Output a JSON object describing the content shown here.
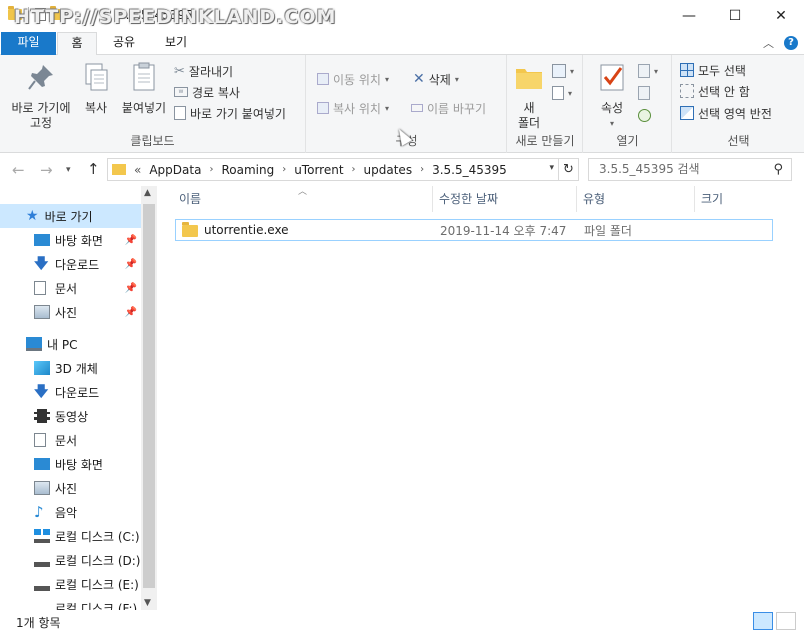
{
  "window": {
    "title": "3.5.5_45395",
    "watermark": "HTTP://SPEEDINKLAND.COM",
    "minimize": "—",
    "maximize": "☐",
    "close": "✕"
  },
  "tabs": [
    "파일",
    "홈",
    "공유",
    "보기"
  ],
  "ribbon": {
    "clipboard": {
      "label": "클립보드",
      "pin_quick": "바로 가기에\n고정",
      "copy": "복사",
      "paste": "붙여넣기",
      "cut": "잘라내기",
      "copy_path": "경로 복사",
      "paste_shortcut": "바로 가기 붙여넣기"
    },
    "organize": {
      "label": "구성",
      "move_to": "이동 위치",
      "copy_to": "복사 위치",
      "delete": "삭제",
      "rename": "이름 바꾸기"
    },
    "new": {
      "label": "새로 만들기",
      "new_folder": "새\n폴더"
    },
    "open": {
      "label": "열기",
      "properties": "속성"
    },
    "select": {
      "label": "선택",
      "select_all": "모두 선택",
      "select_none": "선택 안 함",
      "invert": "선택 영역 반전"
    }
  },
  "address": {
    "overflow": "«",
    "crumbs": [
      "AppData",
      "Roaming",
      "uTorrent",
      "updates",
      "3.5.5_45395"
    ],
    "search_placeholder": "3.5.5_45395 검색"
  },
  "navpane": {
    "quick_access": "바로 가기",
    "quick_items": [
      "바탕 화면",
      "다운로드",
      "문서",
      "사진"
    ],
    "this_pc": "내 PC",
    "pc_items": [
      "3D 개체",
      "다운로드",
      "동영상",
      "문서",
      "바탕 화면",
      "사진",
      "음악",
      "로컬 디스크 (C:)",
      "로컬 디스크 (D:)",
      "로컬 디스크 (E:)",
      "로컬 디스크 (F:)"
    ]
  },
  "columns": {
    "name": "이름",
    "modified": "수정한 날짜",
    "type": "유형",
    "size": "크기"
  },
  "files": [
    {
      "name": "utorrentie.exe",
      "modified": "2019-11-14 오후 7:47",
      "type": "파일 폴더",
      "size": ""
    }
  ],
  "status": {
    "count": "1개 항목"
  },
  "colors": {
    "accent": "#1979ca",
    "selection": "#cce8ff",
    "folder": "#f3c74d"
  }
}
